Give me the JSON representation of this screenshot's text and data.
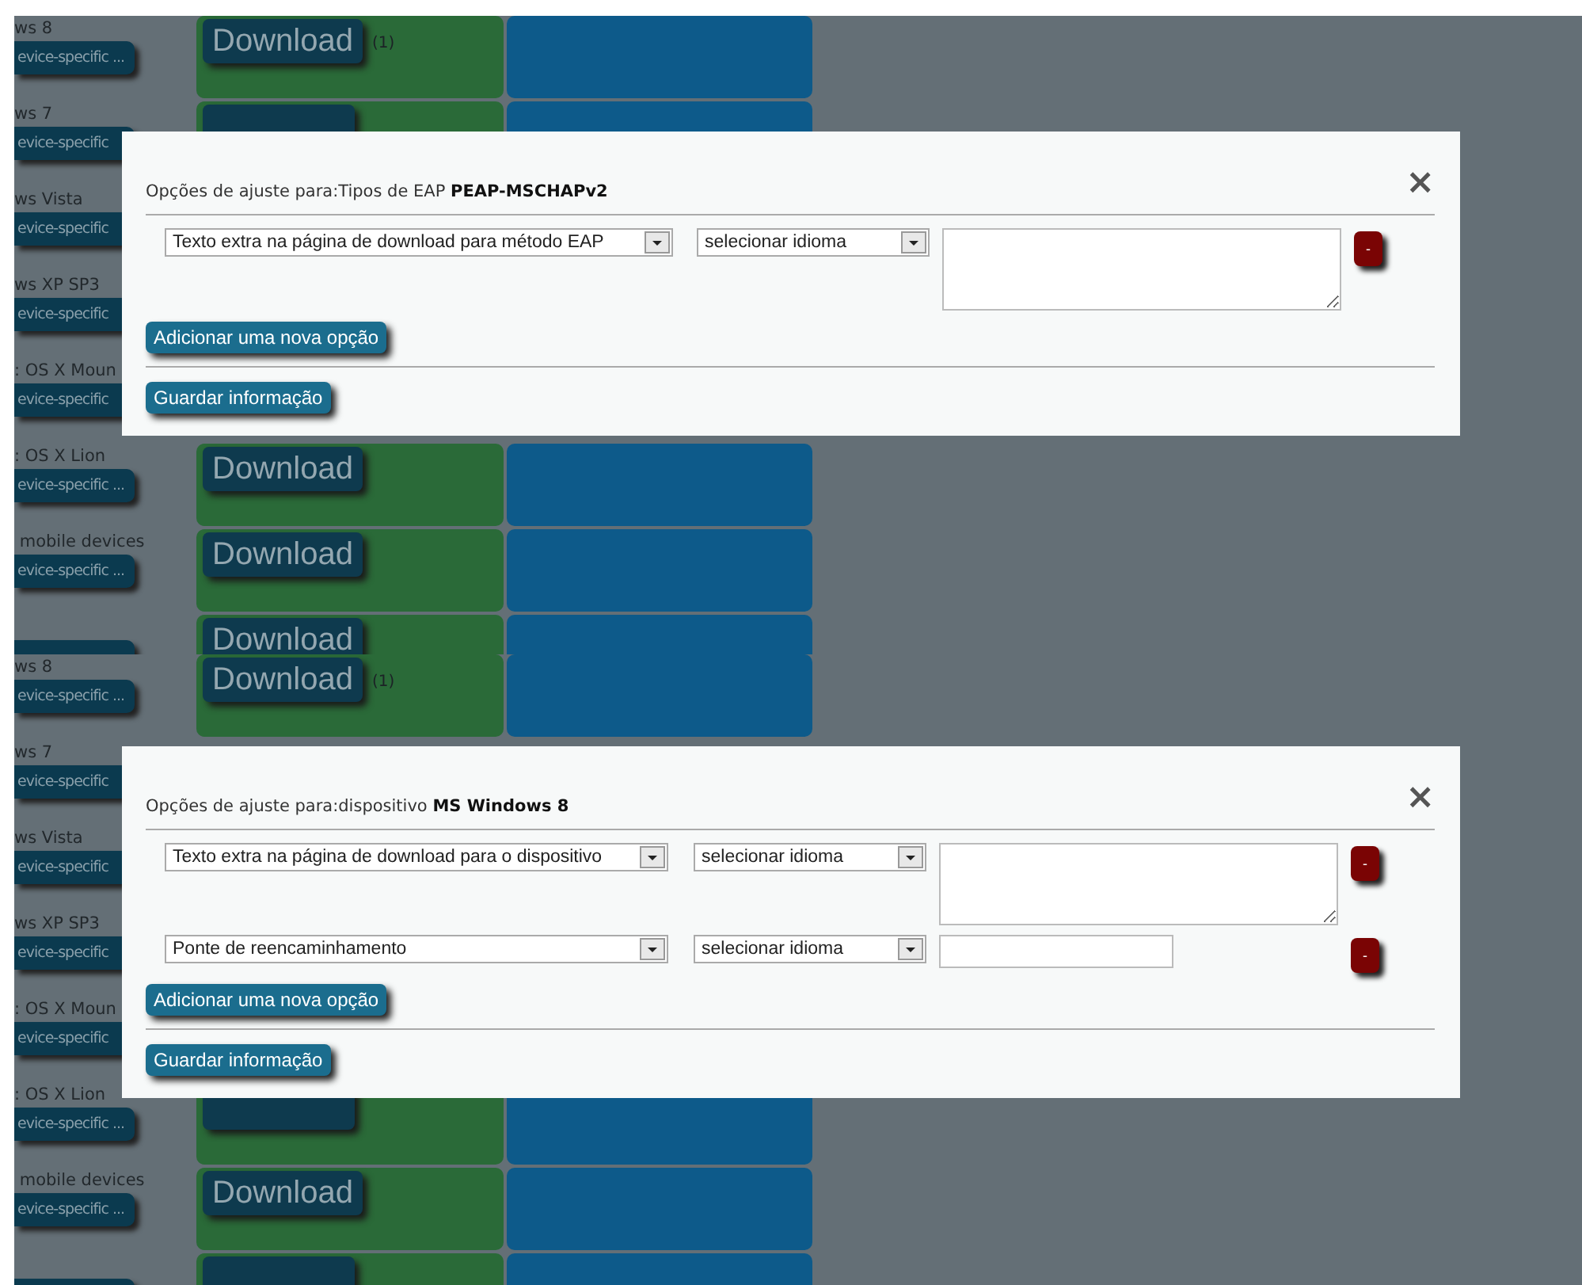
{
  "frames": [
    {
      "rows": [
        {
          "device": "ws 8",
          "button": "evice-specific ...",
          "download": "Download",
          "count": "(1)"
        },
        {
          "device": "ws 7",
          "button": "evice-specific",
          "download_shape": true
        },
        {
          "device": "ws Vista",
          "button": "evice-specific"
        },
        {
          "device": "ws XP SP3",
          "button": "evice-specific"
        },
        {
          "device": ": OS X Moun",
          "button": "evice-specific"
        },
        {
          "device": ": OS X Lion",
          "button": "evice-specific ...",
          "download": "Download"
        },
        {
          "device": " mobile devices",
          "button": "evice-specific ...",
          "download": "Download"
        },
        {
          "button_shape": true,
          "download": "Download"
        }
      ],
      "dialog": {
        "title": "Opções de ajuste para:Tipos de EAP **PEAP-MSCHAPv2**",
        "close": "×",
        "options": [
          {
            "kind": "textarea",
            "type": "Texto extra na página de download para método EAP",
            "language": "selecionar idioma",
            "remove": "-"
          }
        ],
        "add_button": "Adicionar uma nova opção",
        "save_button": "Guardar informação"
      }
    },
    {
      "rows": [
        {
          "device": "ws 8",
          "button": "evice-specific ...",
          "download": "Download",
          "count": "(1)"
        },
        {
          "device": "ws 7",
          "button": "evice-specific"
        },
        {
          "device": "ws Vista",
          "button": "evice-specific"
        },
        {
          "device": "ws XP SP3",
          "button": "evice-specific"
        },
        {
          "device": ": OS X Moun",
          "button": "evice-specific"
        },
        {
          "device": ": OS X Lion",
          "button": "evice-specific ...",
          "download_shape": true
        },
        {
          "device": " mobile devices",
          "button": "evice-specific ...",
          "download": "Download"
        },
        {
          "button_shape": true,
          "download_shape": true
        }
      ],
      "dialog": {
        "title": "Opções de ajuste para:dispositivo **MS Windows 8**",
        "close": "×",
        "options": [
          {
            "kind": "textarea",
            "type": "Texto extra na página de download para o dispositivo",
            "language": "selecionar idioma",
            "remove": "-"
          },
          {
            "kind": "input",
            "type": "Ponte de reencaminhamento",
            "language": "selecionar idioma",
            "remove": "-"
          }
        ],
        "add_button": "Adicionar uma nova opção",
        "save_button": "Guardar informação"
      }
    }
  ]
}
